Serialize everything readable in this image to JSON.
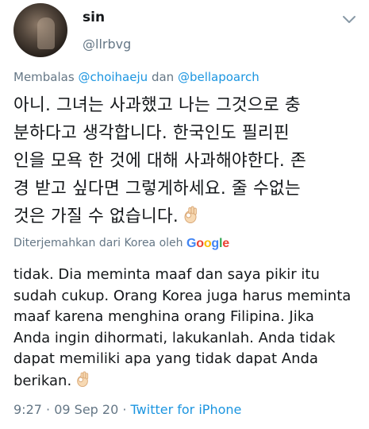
{
  "author": {
    "display_name": "sin",
    "handle": "@llrbvg"
  },
  "reply_context": {
    "prefix": "Membalas",
    "mention1": "@choihaeju",
    "conjunction": "dan",
    "mention2": "@bellapoarch"
  },
  "original_text": {
    "lines": [
      "아니. 그녀는 사과했고 나는 그것으로 충",
      "분하다고 생각합니다. 한국인도 필리핀",
      "인을 모욕 한 것에 대해 사과해야한다. 존",
      "경 받고 싶다면 그렇게하세요. 줄 수없는",
      "것은 가질 수 없습니다."
    ],
    "emoji": "ok-hand"
  },
  "translation": {
    "label": "Diterjemahkan dari Korea oleh",
    "provider": "Google",
    "provider_colors": [
      "#4285F4",
      "#EA4335",
      "#FBBC05",
      "#4285F4",
      "#34A853",
      "#EA4335"
    ],
    "lines": [
      "tidak. Dia meminta maaf dan saya pikir itu",
      "sudah cukup. Orang Korea juga harus meminta",
      "maaf karena menghina orang Filipina. Jika",
      "Anda ingin dihormati, lakukanlah. Anda tidak",
      "dapat memiliki apa yang tidak dapat Anda",
      "berikan."
    ]
  },
  "meta": {
    "time": "9:27",
    "separator": "·",
    "date": "09 Sep 20",
    "source": "Twitter for iPhone"
  },
  "colors": {
    "text": "#14171a",
    "secondary": "#657786",
    "link": "#1b95e0"
  },
  "icons": {
    "more": "chevron-down-icon",
    "emoji": "ok-hand-icon"
  }
}
